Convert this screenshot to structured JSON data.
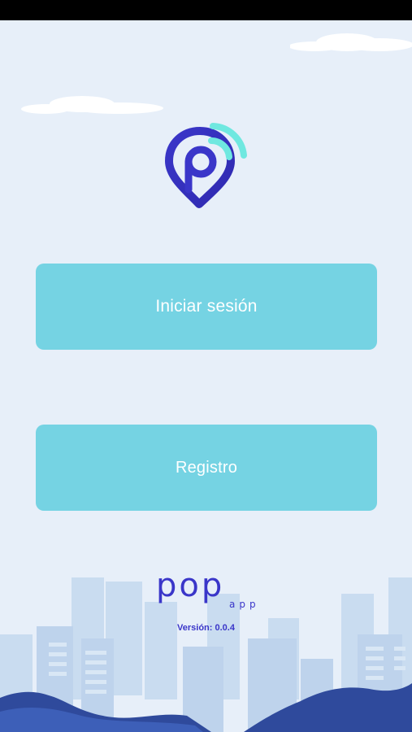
{
  "app": {
    "brand_name": "pop",
    "brand_suffix": "app",
    "logo_icon": "location-pin-wifi-icon"
  },
  "actions": {
    "login_label": "Iniciar sesión",
    "register_label": "Registro"
  },
  "footer": {
    "version_text": "Versión: 0.0.4"
  },
  "colors": {
    "background": "#e7eff9",
    "button": "#75d3e3",
    "brand": "#3a36c9",
    "logo_accent": "#6fe8e0",
    "hills": "#2f4a9c"
  }
}
